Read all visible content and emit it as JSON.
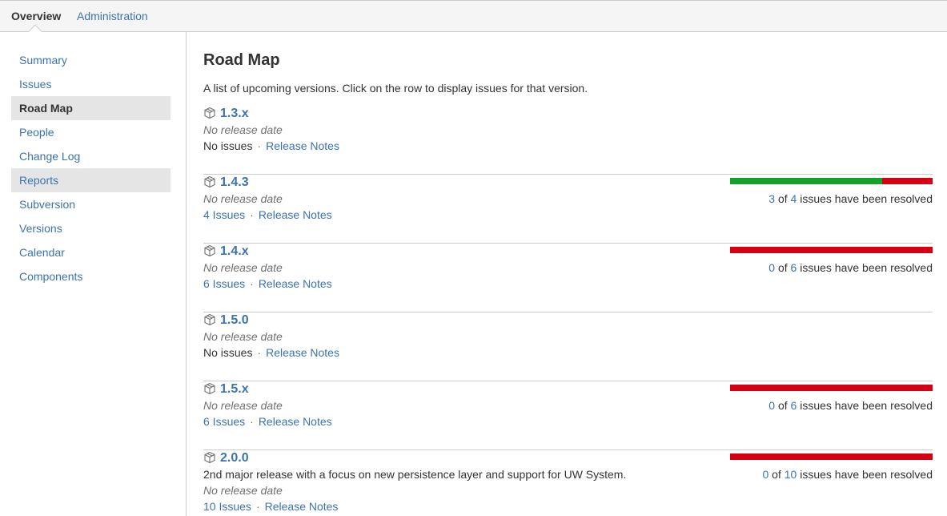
{
  "topnav": {
    "tabs": [
      {
        "label": "Overview",
        "active": true
      },
      {
        "label": "Administration",
        "active": false
      }
    ]
  },
  "sidebar": {
    "items": [
      {
        "label": "Summary",
        "state": "normal"
      },
      {
        "label": "Issues",
        "state": "normal"
      },
      {
        "label": "Road Map",
        "state": "active"
      },
      {
        "label": "People",
        "state": "normal"
      },
      {
        "label": "Change Log",
        "state": "normal"
      },
      {
        "label": "Reports",
        "state": "hover"
      },
      {
        "label": "Subversion",
        "state": "normal"
      },
      {
        "label": "Versions",
        "state": "normal"
      },
      {
        "label": "Calendar",
        "state": "normal"
      },
      {
        "label": "Components",
        "state": "normal"
      }
    ]
  },
  "main": {
    "title": "Road Map",
    "description": "A list of upcoming versions. Click on the row to display issues for that version.",
    "release_notes_label": "Release Notes",
    "resolved_suffix": "issues have been resolved",
    "of_word": "of",
    "icon": "package-box-icon",
    "versions": [
      {
        "name": "1.3.x",
        "description": null,
        "date": "No release date",
        "issues_label": "No issues",
        "issues_link": false,
        "resolved": null,
        "total": null
      },
      {
        "name": "1.4.3",
        "description": null,
        "date": "No release date",
        "issues_label": "4 Issues",
        "issues_link": true,
        "resolved": "3",
        "total": "4"
      },
      {
        "name": "1.4.x",
        "description": null,
        "date": "No release date",
        "issues_label": "6 Issues",
        "issues_link": true,
        "resolved": "0",
        "total": "6"
      },
      {
        "name": "1.5.0",
        "description": null,
        "date": "No release date",
        "issues_label": "No issues",
        "issues_link": false,
        "resolved": null,
        "total": null
      },
      {
        "name": "1.5.x",
        "description": null,
        "date": "No release date",
        "issues_label": "6 Issues",
        "issues_link": true,
        "resolved": "0",
        "total": "6"
      },
      {
        "name": "2.0.0",
        "description": "2nd major release with a focus on new persistence layer and support for UW System.",
        "date": "No release date",
        "issues_label": "10 Issues",
        "issues_link": true,
        "resolved": "0",
        "total": "10"
      }
    ]
  },
  "colors": {
    "link": "#3b73af",
    "progress_done": "#14a12c",
    "progress_todo": "#d60015"
  }
}
